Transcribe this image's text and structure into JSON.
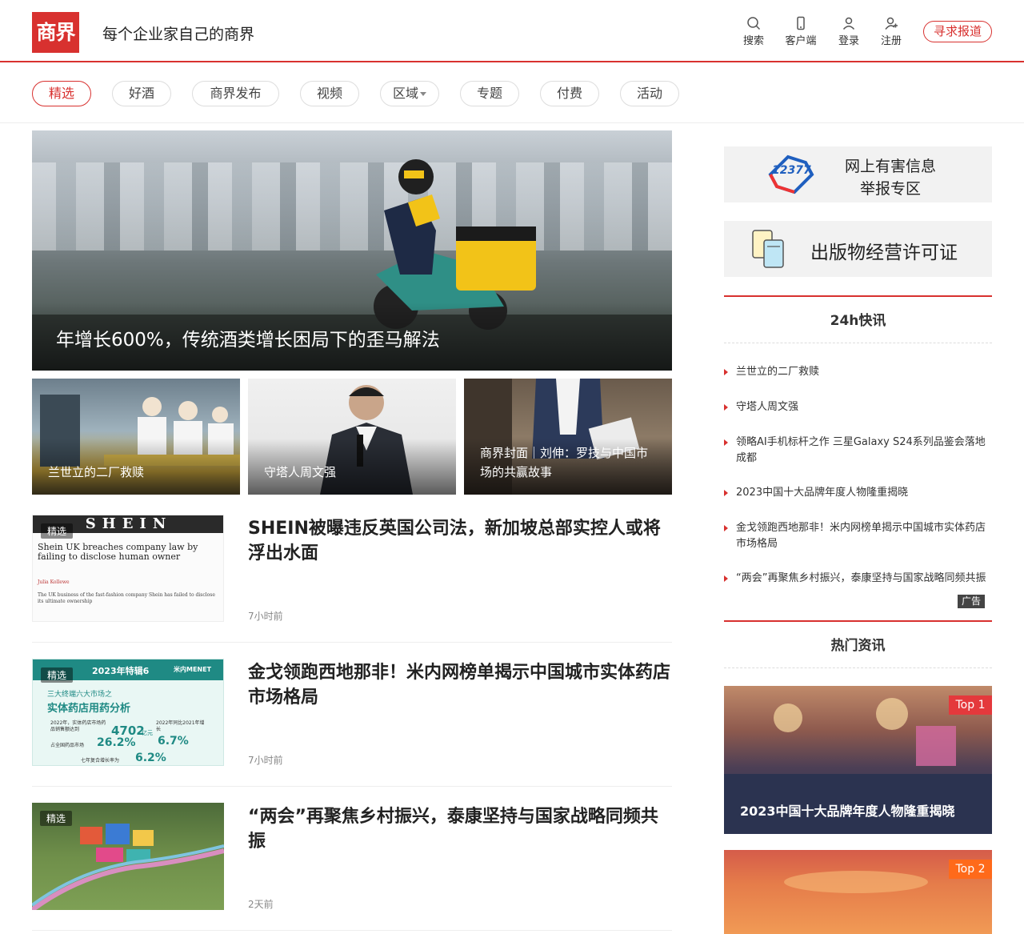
{
  "header": {
    "logo": "商界",
    "slogan": "每个企业家自己的商界",
    "tools": [
      "搜索",
      "客户端",
      "登录",
      "注册"
    ],
    "seek_button": "寻求报道"
  },
  "nav": {
    "items": [
      "精选",
      "好酒",
      "商界发布",
      "视频",
      "区域",
      "专题",
      "付费",
      "活动"
    ]
  },
  "hero": {
    "title": "年增长600%，传统酒类增长困局下的歪马解法"
  },
  "thumbs": [
    {
      "title": "兰世立的二厂救赎"
    },
    {
      "title": "守塔人周文强"
    },
    {
      "title": "商界封面｜刘伸：罗技与中国市场的共赢故事"
    }
  ],
  "articles": [
    {
      "badge": "精选",
      "title": "SHEIN被曝违反英国公司法，新加坡总部实控人或将浮出水面",
      "time": "7小时前",
      "img_text": [
        "SHEIN",
        "Shein UK breaches company law by failing to disclose human owner",
        "Julia Kollewe",
        "The UK business of the fast-fashion company Shein has failed to disclose its ultimate ownership"
      ]
    },
    {
      "badge": "精选",
      "title": "金戈领跑西地那非！米内网榜单揭示中国城市实体药店市场格局",
      "time": "7小时前",
      "img_text": [
        "2023年特辑6",
        "米内MENET",
        "三大终端六大市场之",
        "实体药店用药分析",
        "2022年，实体药店市场药品销售额达到",
        "4702",
        "亿元",
        "2022年同比2021年增长",
        "6.7%",
        "占全国药品市场",
        "26.2%",
        "七年复合增长率为",
        "6.2%"
      ]
    },
    {
      "badge": "精选",
      "title": "“两会”再聚焦乡村振兴，泰康坚持与国家战略同频共振",
      "time": "2天前"
    }
  ],
  "sidebar": {
    "banner1": {
      "logo": "12377",
      "line1": "网上有害信息",
      "line2": "举报专区"
    },
    "banner2": {
      "text": "出版物经营许可证"
    },
    "flash_title": "24h快讯",
    "flash": [
      "兰世立的二厂救赎",
      "守塔人周文强",
      "领略AI手机标杆之作 三星Galaxy S24系列品鉴会落地成都",
      "2023中国十大品牌年度人物隆重揭晓",
      "金戈领跑西地那非！米内网榜单揭示中国城市实体药店市场格局",
      "“两会”再聚焦乡村振兴，泰康坚持与国家战略同频共振"
    ],
    "ad_label": "广告",
    "hot_title": "热门资讯",
    "hot": [
      {
        "tag": "Top 1",
        "title": "2023中国十大品牌年度人物隆重揭晓",
        "tag_color": "#e4393c"
      },
      {
        "tag": "Top 2",
        "title": "",
        "tag_color": "#ff6a1a"
      }
    ]
  },
  "colors": {
    "accent": "#d8312f"
  }
}
